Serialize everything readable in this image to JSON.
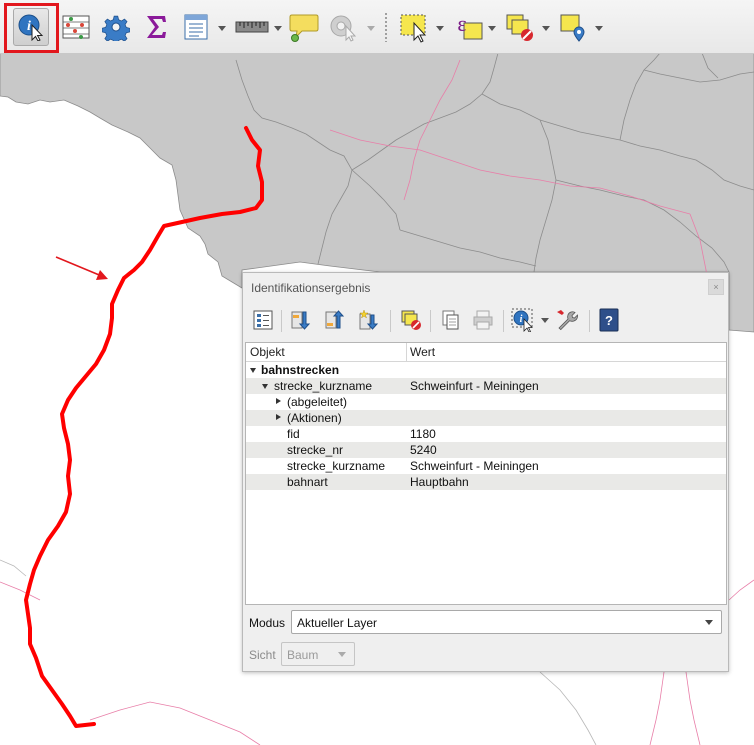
{
  "toolbar": {
    "tools": [
      {
        "name": "identify-features-icon"
      },
      {
        "name": "attributes-table-icon"
      },
      {
        "name": "processing-gear-icon"
      },
      {
        "name": "statistics-sum-icon"
      },
      {
        "name": "field-calculator-icon"
      },
      {
        "name": "measure-ruler-icon"
      },
      {
        "name": "map-tips-icon"
      },
      {
        "name": "run-action-icon"
      },
      {
        "name": "select-features-icon"
      },
      {
        "name": "select-by-expression-icon"
      },
      {
        "name": "deselect-features-icon"
      },
      {
        "name": "select-by-location-icon"
      }
    ],
    "highlight_color": "#e2171d"
  },
  "map": {
    "admin_fill": "#c8c8c8",
    "admin_border": "#8c8c8c",
    "rail_color": "#e87ea8",
    "selected_line_color": "#ff0000",
    "annotation_arrow_color": "#e2171d"
  },
  "panel": {
    "title": "Identifikationsergebnis",
    "close_label": "×",
    "columns": {
      "object": "Objekt",
      "value": "Wert"
    },
    "rows": [
      {
        "key": "bahnstrecken",
        "value": ""
      },
      {
        "key": "strecke_kurzname",
        "value": "Schweinfurt - Meiningen"
      },
      {
        "key": "(abgeleitet)",
        "value": ""
      },
      {
        "key": "(Aktionen)",
        "value": ""
      },
      {
        "key": "fid",
        "value": "1180"
      },
      {
        "key": "strecke_nr",
        "value": "5240"
      },
      {
        "key": "strecke_kurzname",
        "value": "Schweinfurt - Meiningen"
      },
      {
        "key": "bahnart",
        "value": "Hauptbahn"
      }
    ],
    "mode": {
      "label": "Modus",
      "value": "Aktueller Layer"
    },
    "view": {
      "label": "Sicht",
      "value": "Baum"
    }
  }
}
